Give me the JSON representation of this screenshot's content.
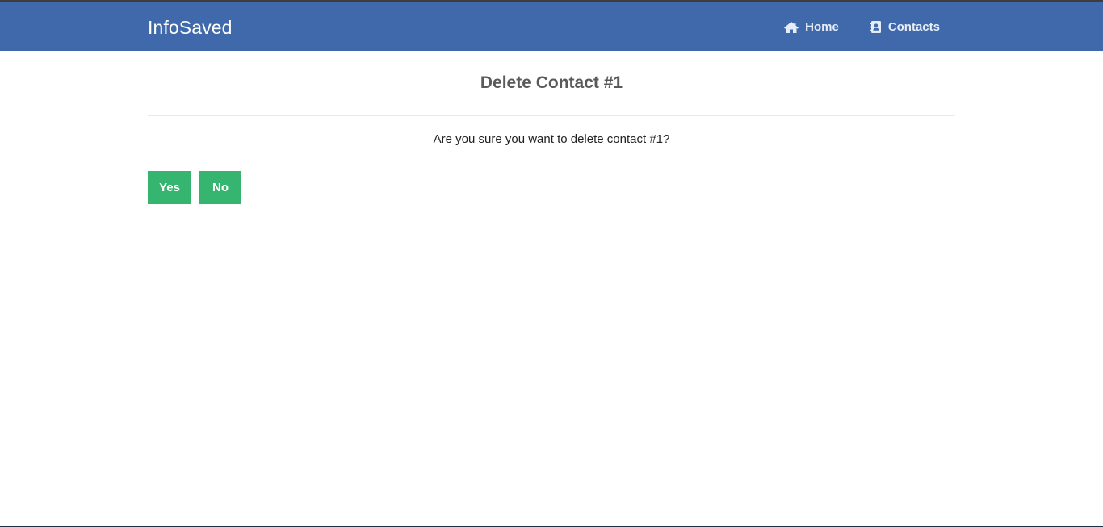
{
  "navbar": {
    "brand": "InfoSaved",
    "links": [
      {
        "label": "Home",
        "icon": "home-icon"
      },
      {
        "label": "Contacts",
        "icon": "address-book-icon"
      }
    ],
    "background": "#3f69aa"
  },
  "main": {
    "title": "Delete Contact #1",
    "prompt": "Are you sure you want to delete contact #1?",
    "buttons": {
      "yes": "Yes",
      "no": "No"
    },
    "button_color": "#35b56f"
  }
}
